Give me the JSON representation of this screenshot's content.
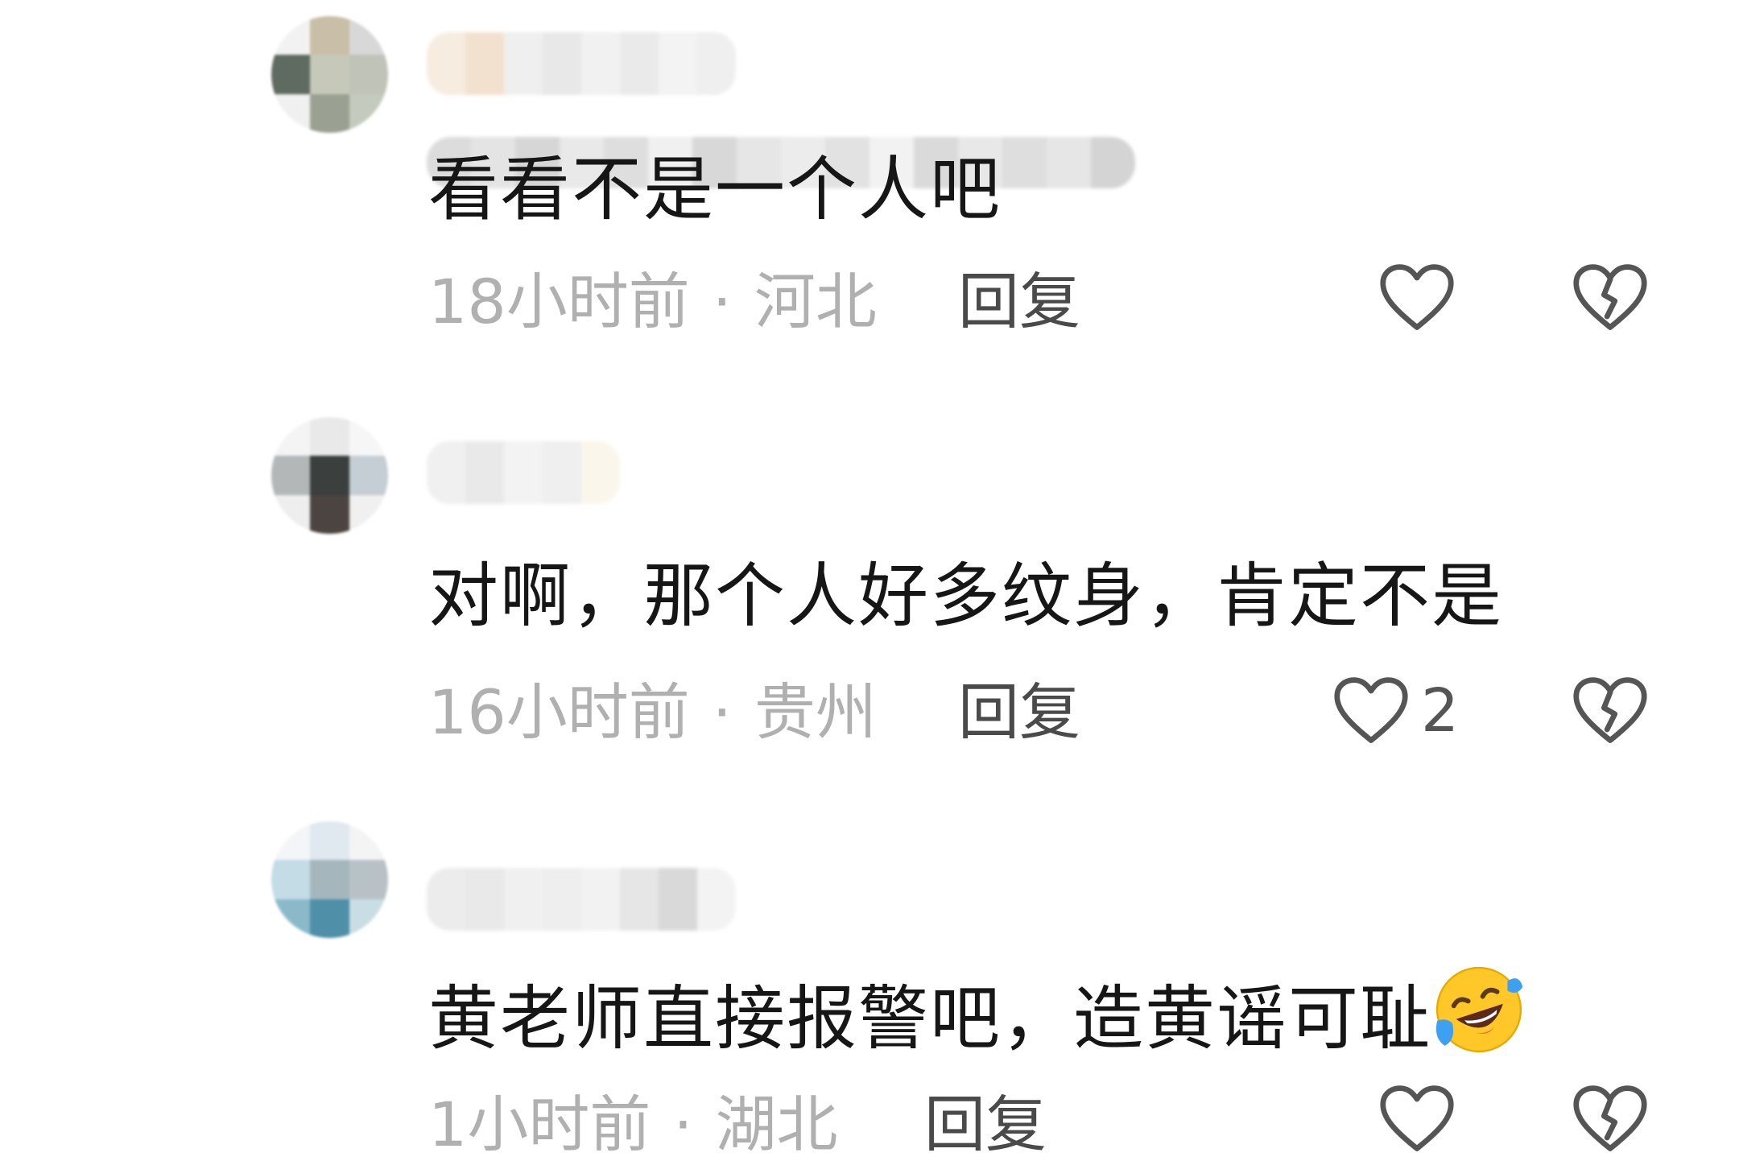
{
  "comments": [
    {
      "text": "看看不是一个人吧",
      "time": "18小时前",
      "location": "河北",
      "reply_label": "回复",
      "like_count": ""
    },
    {
      "text": "对啊，那个人好多纹身，肯定不是",
      "time": "16小时前",
      "location": "贵州",
      "reply_label": "回复",
      "like_count": "2"
    },
    {
      "text": "黄老师直接报警吧，造黄谣可耻",
      "emoji": "laughing-crying-emoji",
      "time": "1小时前",
      "location": "湖北",
      "reply_label": "回复",
      "like_count": ""
    }
  ],
  "separator": "·",
  "icons": {
    "like": "heart-outline-icon",
    "dislike": "broken-heart-icon"
  },
  "colors": {
    "text": "#161616",
    "meta": "#b0b0b0",
    "reply": "#4a4a4a",
    "icon": "#555555",
    "emoji_face": "#ffc727",
    "emoji_tear": "#3ea0f0"
  }
}
